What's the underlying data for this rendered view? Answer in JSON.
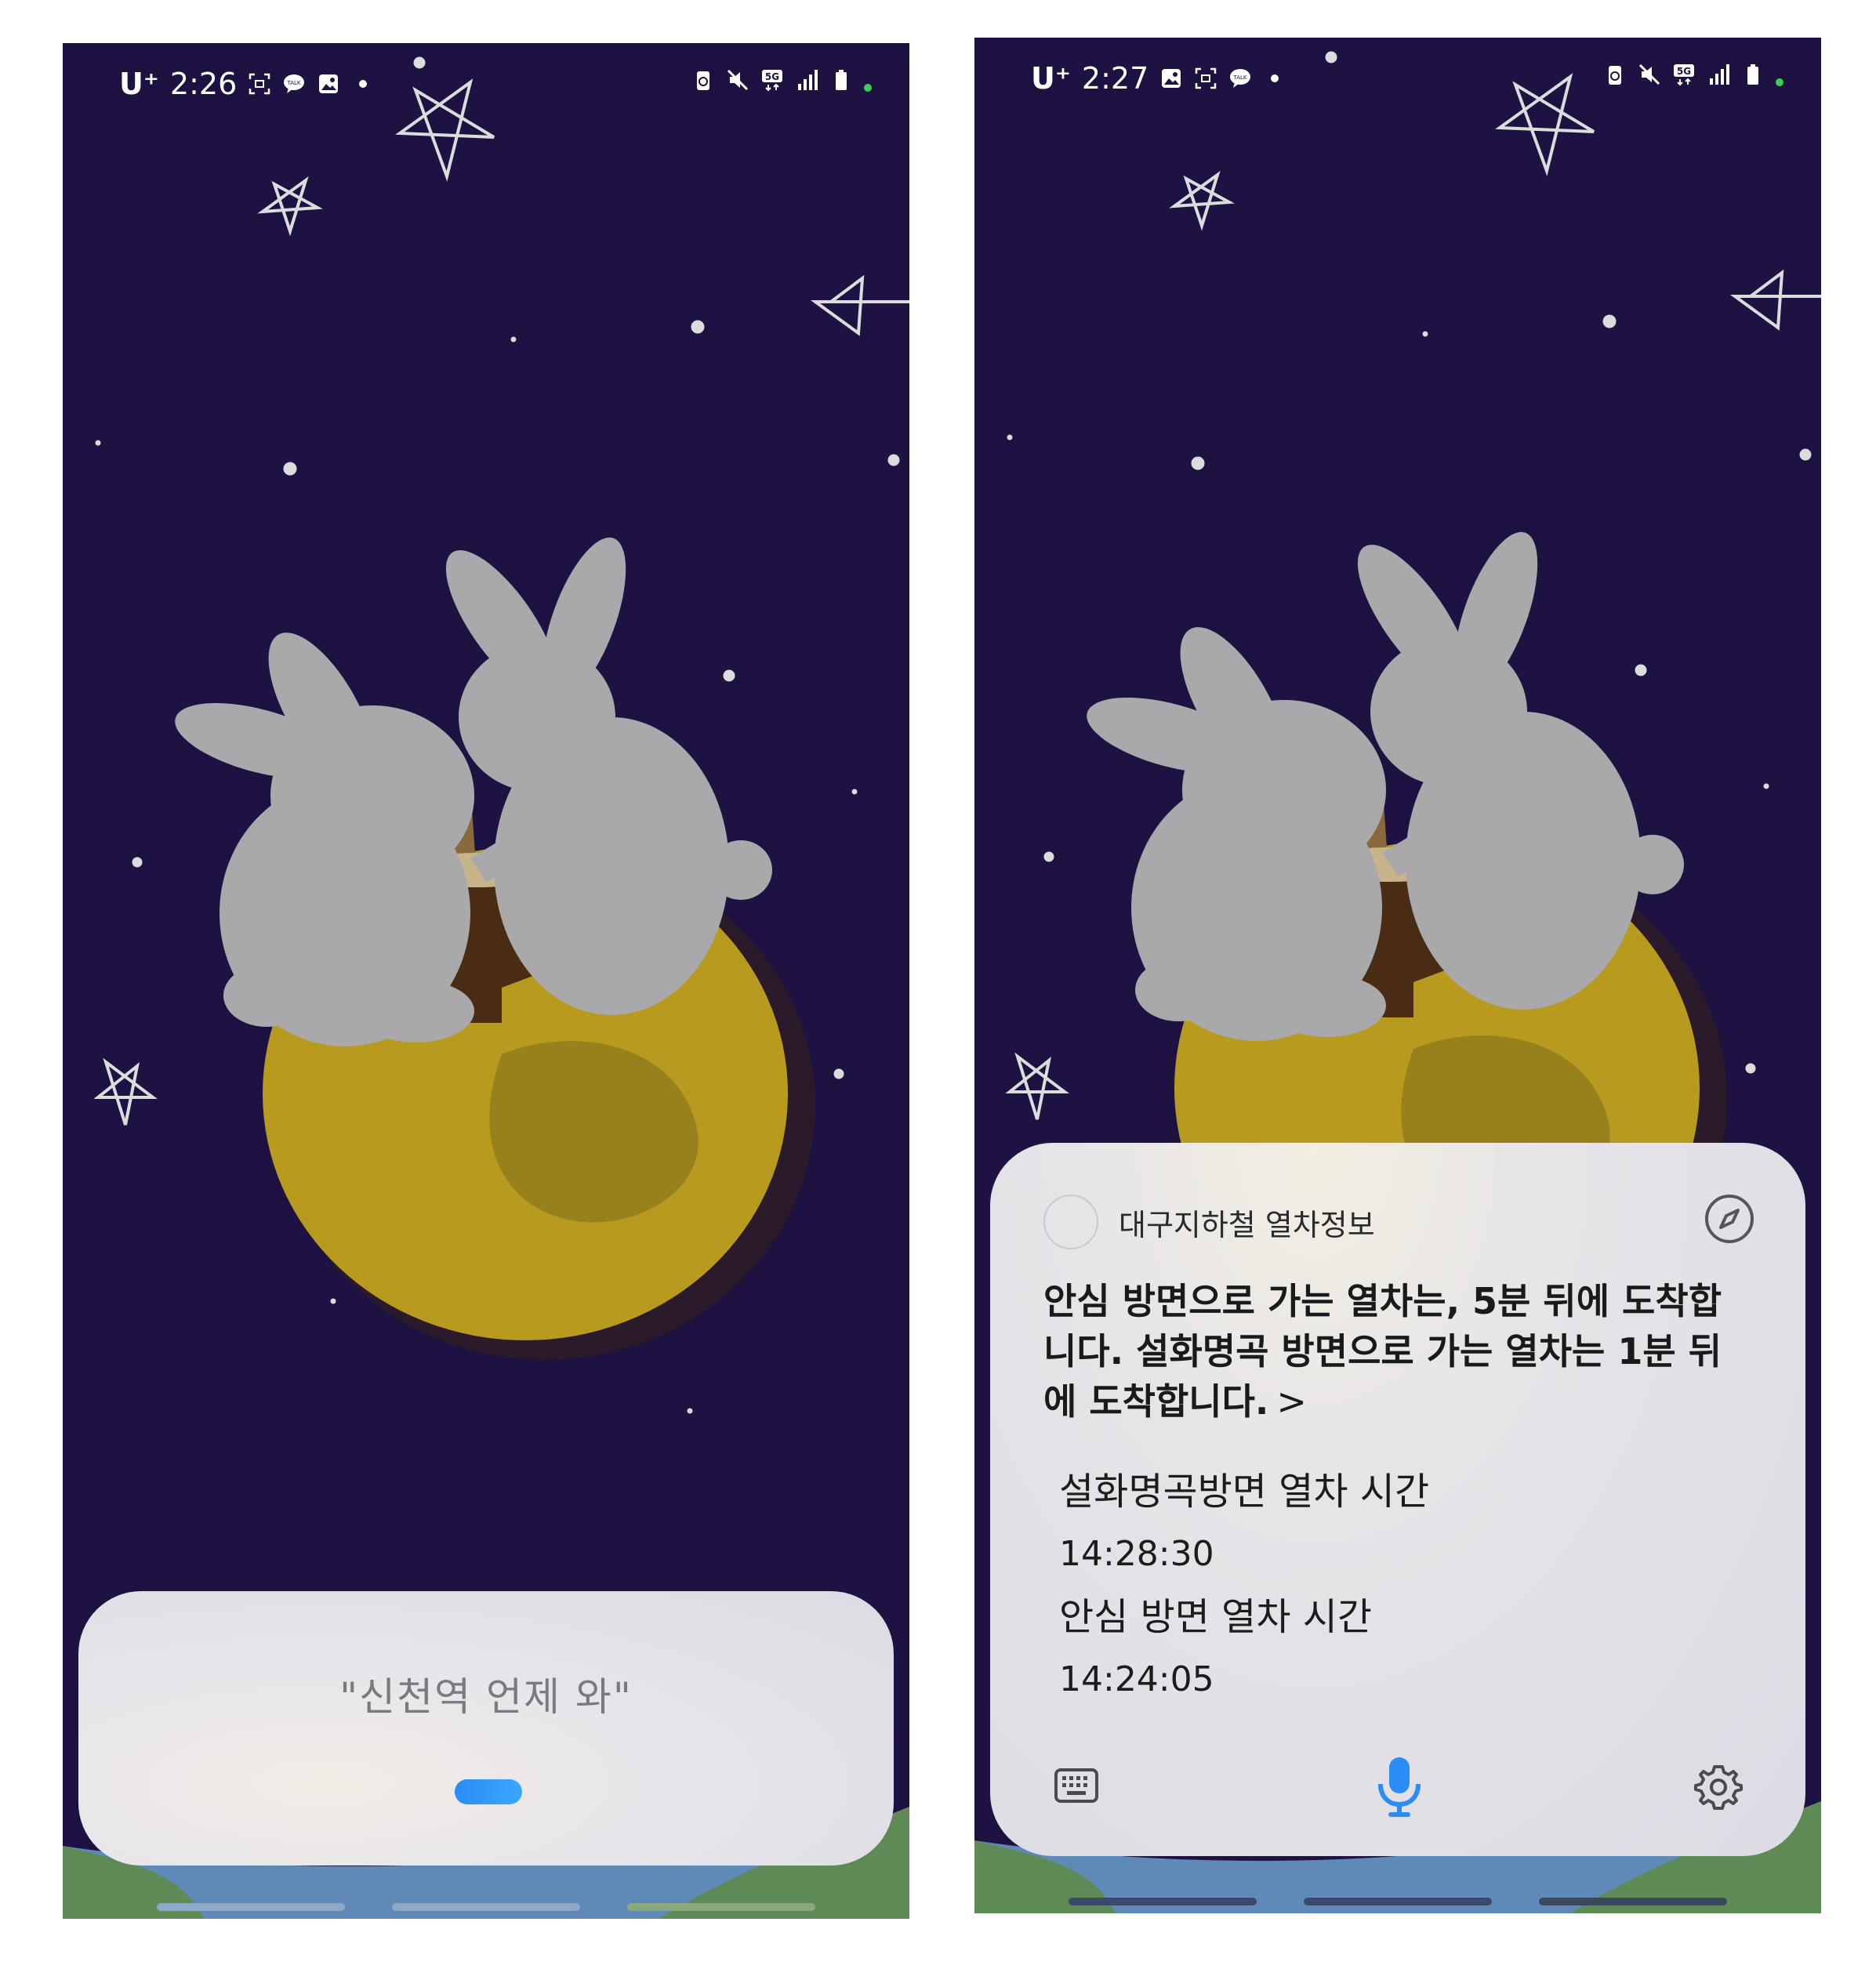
{
  "left_screen": {
    "status": {
      "carrier": "U⁺",
      "time": "2:26"
    },
    "query": "\"신천역 언제 와\""
  },
  "right_screen": {
    "status": {
      "carrier": "U⁺",
      "time": "2:27"
    },
    "app_name": "대구지하철 열차정보",
    "answer": "안심 방면으로 가는 열차는, 5분 뒤에 도착합니다. 설화명곡 방면으로 가는 열차는 1분 뒤에 도착합니다.",
    "answer_chevron": ">",
    "info": [
      {
        "label": "설화명곡방면 열차 시간",
        "time": "14:28:30"
      },
      {
        "label": "안심 방면 열차 시간",
        "time": "14:24:05"
      }
    ]
  },
  "colors": {
    "night_sky": "#1e1242",
    "moon": "#b89a1e",
    "rabbit": "#a9a9ab",
    "mortar": "#4a2c14",
    "accent_blue": "#2a8cf5"
  },
  "icons": [
    "screenshot-icon",
    "kakaotalk-icon",
    "gallery-icon",
    "battery-saver-icon",
    "mute-icon",
    "5g-icon",
    "signal-icon",
    "battery-icon",
    "compass-icon",
    "keyboard-icon",
    "microphone-icon",
    "settings-icon"
  ]
}
